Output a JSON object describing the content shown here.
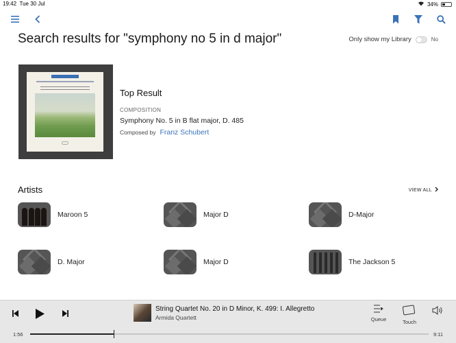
{
  "status": {
    "time": "19:42",
    "date": "Tue 30 Jul",
    "battery_text": "34%",
    "battery_level": 0.34
  },
  "toolbar": {
    "menu_icon": "hamburger-icon",
    "back_icon": "chevron-left-icon",
    "bookmark_icon": "bookmark-icon",
    "filter_icon": "filter-icon",
    "search_icon": "search-icon"
  },
  "page": {
    "title": "Search results for \"symphony no 5 in d major\"",
    "library_toggle_label": "Only show my Library",
    "library_toggle_state": "No"
  },
  "top_result": {
    "heading": "Top Result",
    "kind": "COMPOSITION",
    "title": "Symphony No. 5 in B flat major, D. 485",
    "composed_by_label": "Composed by",
    "composer": "Franz Schubert"
  },
  "artists": {
    "heading": "Artists",
    "view_all": "VIEW ALL",
    "items": [
      {
        "name": "Maroon 5",
        "image": "photo"
      },
      {
        "name": "Major D",
        "image": "placeholder"
      },
      {
        "name": "D-Major",
        "image": "placeholder"
      },
      {
        "name": "D. Major",
        "image": "placeholder"
      },
      {
        "name": "Major D",
        "image": "placeholder"
      },
      {
        "name": "The Jackson 5",
        "image": "photo"
      }
    ]
  },
  "player": {
    "track": "String Quartet No. 20 in D Minor, K. 499: I. Allegretto",
    "artist": "Armida Quartett",
    "elapsed": "1:56",
    "total": "9:11",
    "progress": 0.21,
    "queue_label": "Queue",
    "touch_label": "Touch"
  },
  "colors": {
    "accent": "#3b73b9",
    "player_bg": "#e7e7e8"
  }
}
